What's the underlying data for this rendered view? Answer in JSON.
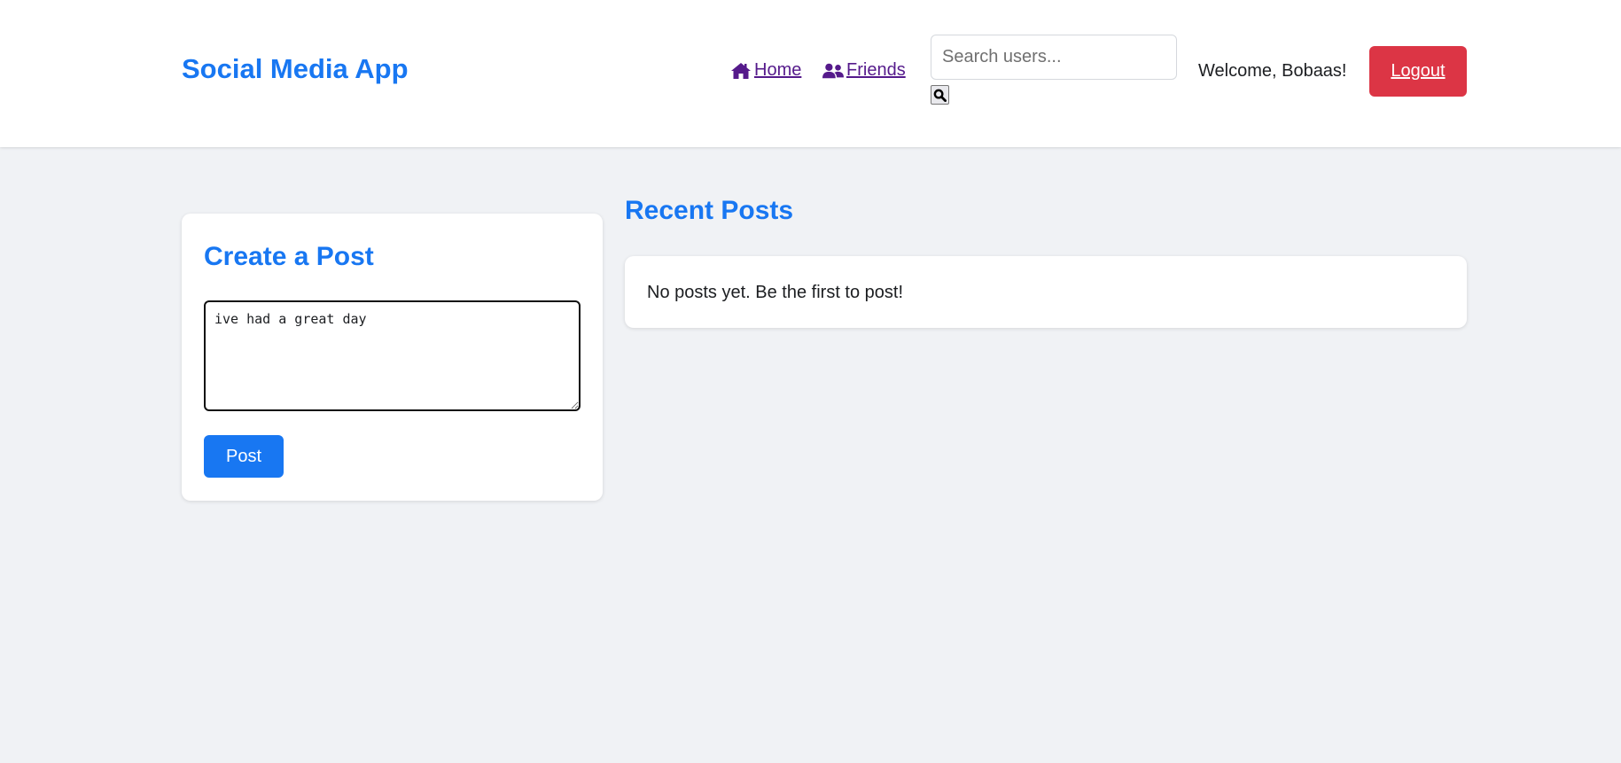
{
  "header": {
    "brand": "Social Media App",
    "nav": {
      "home_label": " Home",
      "home_icon": "home-icon",
      "friends_label": " Friends",
      "friends_icon": "users-icon"
    },
    "search": {
      "placeholder": "Search users...",
      "value": "",
      "button_icon": "search-icon"
    },
    "welcome": "Welcome, Bobaas!",
    "logout_label": "Logout"
  },
  "create_post": {
    "title": "Create a Post",
    "textarea_value": "ive had a great day",
    "post_button_label": "Post"
  },
  "feed": {
    "title": "Recent Posts",
    "empty_message": "No posts yet. Be the first to post!"
  },
  "colors": {
    "brand": "#1877f2",
    "logout": "#dc3545",
    "background": "#f0f2f5",
    "visited_link": "#551a8b"
  }
}
